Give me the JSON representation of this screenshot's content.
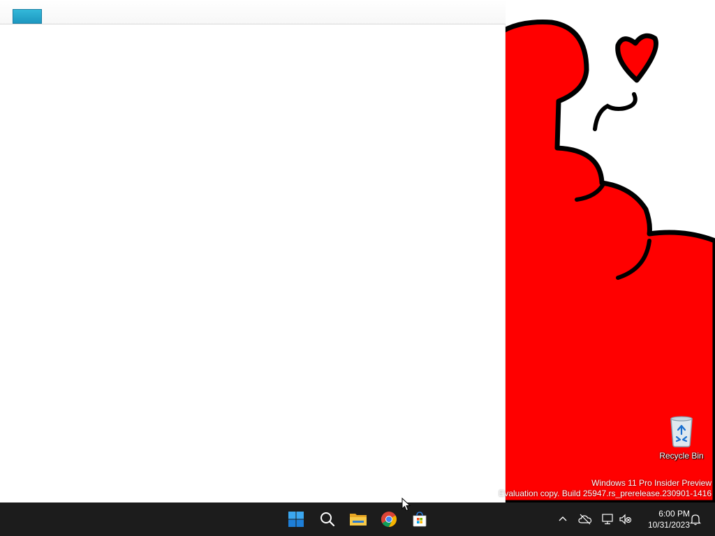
{
  "desktop": {
    "icons": [
      {
        "label": "Recycle Bin",
        "icon": "recycle-bin-icon"
      }
    ],
    "watermark": {
      "line1": "Windows 11 Pro Insider Preview",
      "line2": "Evaluation copy. Build 25947.rs_prerelease.230901-1416"
    },
    "wallpaper_color": "#ff0000"
  },
  "taskbar": {
    "pinned": [
      {
        "icon": "windows-start-icon"
      },
      {
        "icon": "search-icon"
      },
      {
        "icon": "file-explorer-icon"
      },
      {
        "icon": "chrome-icon"
      },
      {
        "icon": "microsoft-store-icon"
      }
    ],
    "tray": {
      "icons": [
        "chevron-up-icon",
        "onedrive-offline-icon",
        "network-icon",
        "volume-muted-icon",
        "notification-bell-icon"
      ],
      "time": "6:00 PM",
      "date": "10/31/2023"
    },
    "background": "#1c1c1c"
  }
}
